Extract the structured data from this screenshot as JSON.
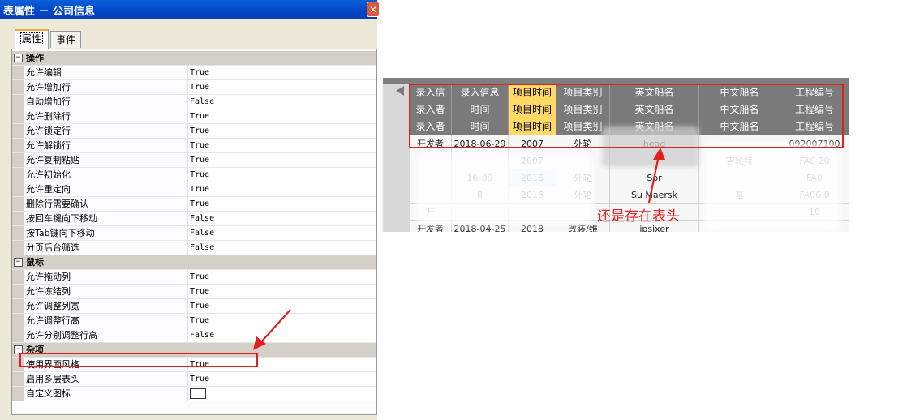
{
  "window": {
    "title": "表属性 － 公司信息",
    "close_glyph": "✕",
    "tabs": [
      {
        "label": "属性"
      },
      {
        "label": "事件"
      }
    ]
  },
  "properties": [
    {
      "category": "操作",
      "toggle": "⊟",
      "rows": [
        {
          "name": "允许编辑",
          "value": "True"
        },
        {
          "name": "允许增加行",
          "value": "True"
        },
        {
          "name": "自动增加行",
          "value": "False"
        },
        {
          "name": "允许删除行",
          "value": "True"
        },
        {
          "name": "允许锁定行",
          "value": "True"
        },
        {
          "name": "允许解锁行",
          "value": "True"
        },
        {
          "name": "允许复制粘贴",
          "value": "True"
        },
        {
          "name": "允许初始化",
          "value": "True"
        },
        {
          "name": "允许重定向",
          "value": "True"
        },
        {
          "name": "删除行需要确认",
          "value": "True"
        },
        {
          "name": "按回车键向下移动",
          "value": "False"
        },
        {
          "name": "按Tab键向下移动",
          "value": "False"
        },
        {
          "name": "分页后台筛选",
          "value": "False"
        }
      ]
    },
    {
      "category": "鼠标",
      "toggle": "⊟",
      "rows": [
        {
          "name": "允许拖动列",
          "value": "True"
        },
        {
          "name": "允许冻结列",
          "value": "True"
        },
        {
          "name": "允许调整列宽",
          "value": "True"
        },
        {
          "name": "允许调整行高",
          "value": "True"
        },
        {
          "name": "允许分别调整行高",
          "value": "False"
        }
      ]
    },
    {
      "category": "杂项",
      "toggle": "⊟",
      "rows": [
        {
          "name": "使用界面风格",
          "value": "True"
        },
        {
          "name": "启用多层表头",
          "value": "True"
        },
        {
          "name": "自定义图标",
          "value": ""
        }
      ]
    }
  ],
  "grid": {
    "header_rows": [
      [
        "录入信",
        "录入信息",
        "项目时间",
        "项目类别",
        "英文船名",
        "中文船名",
        "工程编号"
      ],
      [
        "录入者",
        "时间",
        "项目时间",
        "项目类别",
        "英文船名",
        "中文船名",
        "工程编号"
      ],
      [
        "录入者",
        "时间",
        "项目时间",
        "项目类别",
        "英文船名",
        "中文船名",
        "工程编号"
      ]
    ],
    "data_rows": [
      [
        "开发者",
        "2018-06-29",
        "2007",
        "外轮",
        "head",
        "",
        "092007100"
      ],
      [
        "",
        "",
        "2007",
        "",
        "",
        "吉轮特",
        "FA0 20"
      ],
      [
        "",
        "16-09",
        "2016",
        "外轮",
        "Sor",
        "",
        "FA0"
      ],
      [
        "",
        "8",
        "2016",
        "外轮",
        "Su Maersk",
        "基",
        "FA06 0"
      ],
      [
        "开",
        "",
        "",
        "",
        "",
        "",
        "10"
      ],
      [
        "开发者",
        "2018-04-25",
        "2018",
        "改装/维",
        "ipsixer",
        "",
        ""
      ]
    ]
  },
  "annotation": "还是存在表头",
  "colors": {
    "highlight_header": "#ffd966",
    "red_box": "#e02020",
    "header_bg": "#7a7a7a"
  }
}
